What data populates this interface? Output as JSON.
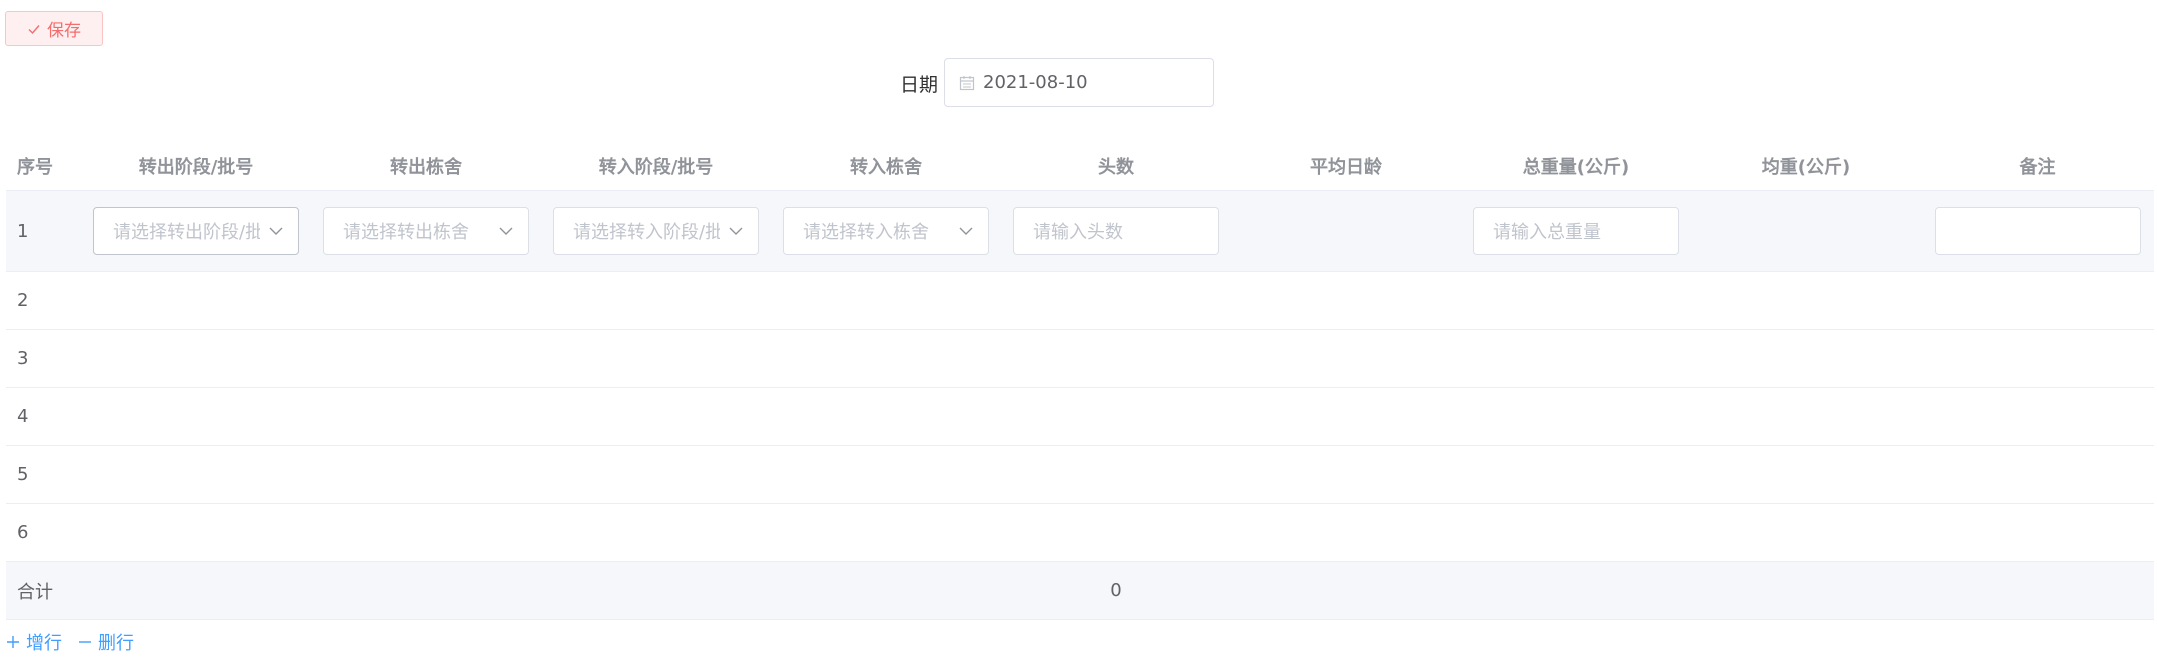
{
  "toolbar": {
    "save_label": "保存"
  },
  "date": {
    "label": "日期",
    "value": "2021-08-10"
  },
  "table": {
    "headers": [
      "序号",
      "转出阶段/批号",
      "转出栋舍",
      "转入阶段/批号",
      "转入栋舍",
      "头数",
      "平均日龄",
      "总重量(公斤)",
      "均重(公斤)",
      "备注"
    ],
    "row1": {
      "index": "1",
      "out_batch_placeholder": "请选择转出阶段/批号",
      "out_barn_placeholder": "请选择转出栋舍",
      "in_batch_placeholder": "请选择转入阶段/批号",
      "in_barn_placeholder": "请选择转入栋舍",
      "count_placeholder": "请输入头数",
      "weight_placeholder": "请输入总重量",
      "remark_value": ""
    },
    "row_indices": [
      "2",
      "3",
      "4",
      "5",
      "6"
    ],
    "total": {
      "label": "合计",
      "count": "0"
    }
  },
  "actions": {
    "add_row": "增行",
    "delete_row": "删行"
  },
  "colors": {
    "danger": "#f56c6c",
    "primary": "#409eff",
    "header_text": "#909399",
    "border": "#dcdfe6"
  }
}
